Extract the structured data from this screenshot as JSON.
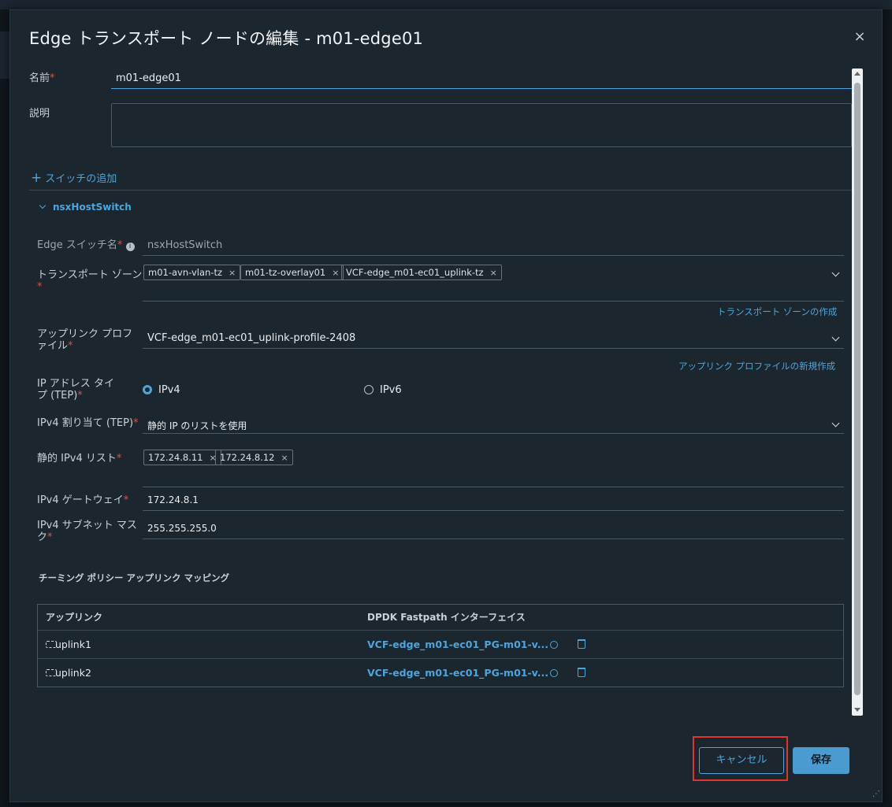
{
  "dialog": {
    "title": "Edge トランスポート ノードの編集 - m01-edge01",
    "close_glyph": "×"
  },
  "form": {
    "name": {
      "label": "名前",
      "value": "m01-edge01"
    },
    "description": {
      "label": "説明",
      "value": ""
    },
    "add_switch_label": "スイッチの追加"
  },
  "switch": {
    "section_title": "nsxHostSwitch",
    "edge_switch_name": {
      "label": "Edge スイッチ名",
      "value": "nsxHostSwitch"
    },
    "transport_zone": {
      "label_line1": "トランスポート ゾーン",
      "tags": [
        "m01-avn-vlan-tz",
        "m01-tz-overlay01",
        "VCF-edge_m01-ec01_uplink-tz"
      ],
      "tag_remove": "×",
      "create_link": "トランスポート ゾーンの作成"
    },
    "uplink_profile": {
      "label_line1": "アップリンク プロフ",
      "label_line2": "ァイル",
      "value": "VCF-edge_m01-ec01_uplink-profile-2408",
      "create_link": "アップリンク プロファイルの新規作成"
    },
    "ip_type": {
      "label_line1": "IP アドレス タイ",
      "label_line2": "プ (TEP)",
      "options": [
        "IPv4",
        "IPv6"
      ],
      "selected": "IPv4"
    },
    "ipv4_assignment": {
      "label": "IPv4 割り当て (TEP)",
      "value": "静的 IP のリストを使用"
    },
    "static_ipv4_list": {
      "label": "静的 IPv4 リスト",
      "tags": [
        "172.24.8.11",
        "172.24.8.12"
      ]
    },
    "ipv4_gateway": {
      "label": "IPv4 ゲートウェイ",
      "value": "172.24.8.1"
    },
    "ipv4_subnet_mask": {
      "label_line1": "IPv4 サブネット マス",
      "label_line2": "ク",
      "value": "255.255.255.0"
    }
  },
  "teaming": {
    "title": "チーミング ポリシー アップリンク マッピング",
    "columns": [
      "アップリンク",
      "DPDK Fastpath インターフェイス"
    ],
    "rows": [
      {
        "uplink": "uplink1",
        "interface": "VCF-edge_m01-ec01_PG-m01-v..."
      },
      {
        "uplink": "uplink2",
        "interface": "VCF-edge_m01-ec01_PG-m01-v..."
      }
    ]
  },
  "footer": {
    "cancel_label": "キャンセル",
    "save_label": "保存"
  },
  "colors": {
    "accent": "#4ea5dc",
    "required": "#e0504a",
    "highlight": "#e0352b",
    "panel": "#1b262e"
  }
}
